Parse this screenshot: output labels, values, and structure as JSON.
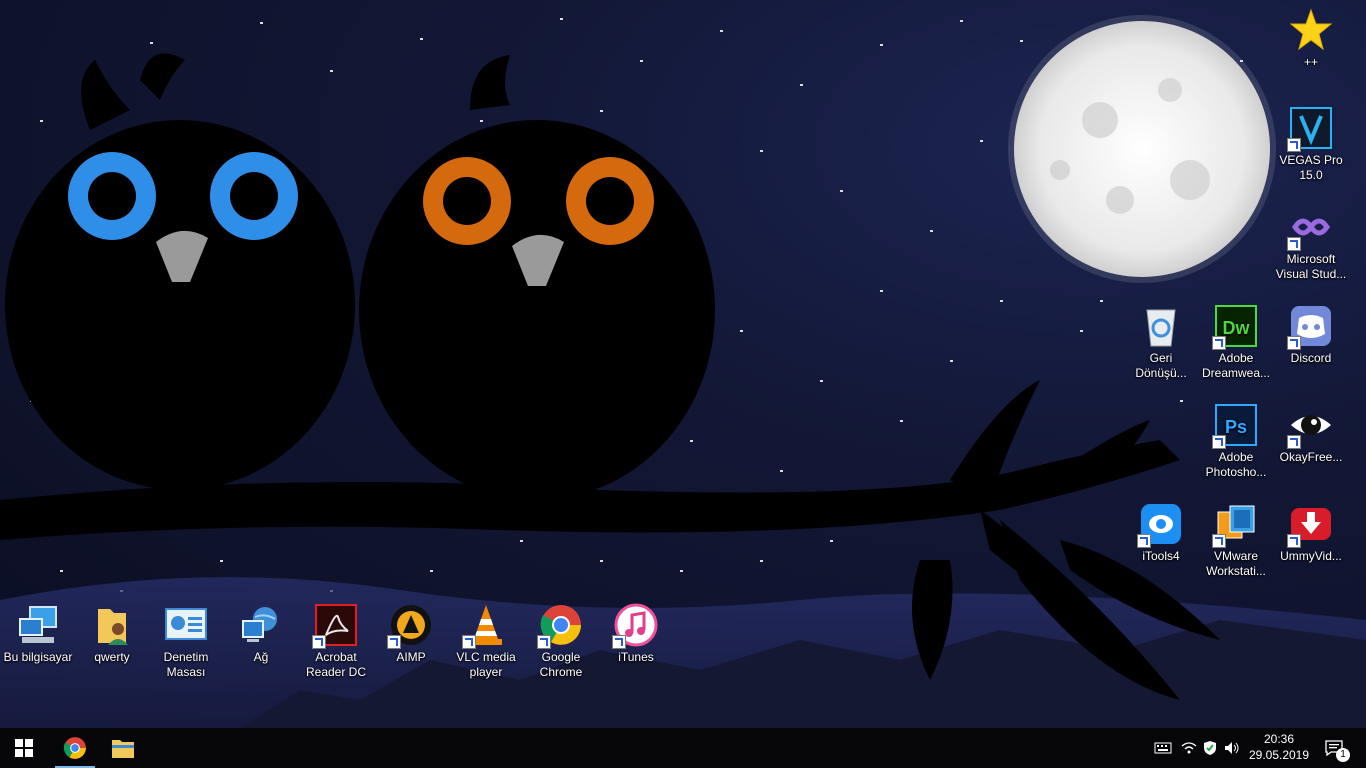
{
  "desktop_icons_left": [
    {
      "id": "bu-bilgisayar",
      "label": "Bu bilgisayar",
      "icon": "computer-icon"
    },
    {
      "id": "qwerty",
      "label": "qwerty",
      "icon": "user-folder-icon"
    },
    {
      "id": "denetim-masasi",
      "label": "Denetim Masası",
      "icon": "control-panel-icon"
    },
    {
      "id": "ag",
      "label": "Ağ",
      "icon": "network-icon"
    },
    {
      "id": "acrobat",
      "label": "Acrobat Reader DC",
      "icon": "acrobat-icon"
    },
    {
      "id": "aimp",
      "label": "AIMP",
      "icon": "aimp-icon"
    },
    {
      "id": "vlc",
      "label": "VLC media player",
      "icon": "vlc-icon"
    },
    {
      "id": "chrome",
      "label": "Google Chrome",
      "icon": "chrome-icon"
    },
    {
      "id": "itunes",
      "label": "iTunes",
      "icon": "itunes-icon"
    }
  ],
  "desktop_icons_right": {
    "plusplus": {
      "label": "++",
      "icon": "star-icon"
    },
    "vegas": {
      "label": "VEGAS Pro 15.0",
      "icon": "vegas-icon"
    },
    "visual_studio": {
      "label": "Microsoft Visual Stud...",
      "icon": "visual-studio-icon"
    },
    "recycle_bin": {
      "label": "Geri Dönüşü...",
      "icon": "recycle-bin-icon"
    },
    "dreamweaver": {
      "label": "Adobe Dreamwea...",
      "icon": "dreamweaver-icon"
    },
    "discord": {
      "label": "Discord",
      "icon": "discord-icon"
    },
    "photoshop": {
      "label": "Adobe Photosho...",
      "icon": "photoshop-icon"
    },
    "okayfree": {
      "label": "OkayFree...",
      "icon": "eye-icon"
    },
    "itools": {
      "label": "iTools4",
      "icon": "itools-icon"
    },
    "vmware": {
      "label": "VMware Workstati...",
      "icon": "vmware-icon"
    },
    "ummy": {
      "label": "UmmyVid...",
      "icon": "ummy-download-icon"
    }
  },
  "taskbar": {
    "start_icon": "windows-start-icon",
    "pinned": [
      {
        "id": "chrome",
        "icon": "chrome-icon",
        "active": true
      },
      {
        "id": "explorer",
        "icon": "file-explorer-icon",
        "active": false
      }
    ],
    "tray": {
      "time": "20:36",
      "date": "29.05.2019",
      "notification_count": "1"
    }
  },
  "colors": {
    "owl_left_eye": "#2f8fe8",
    "owl_right_eye": "#d4690d",
    "taskbar_bg": "#060608",
    "accent": "#76b9ed"
  }
}
